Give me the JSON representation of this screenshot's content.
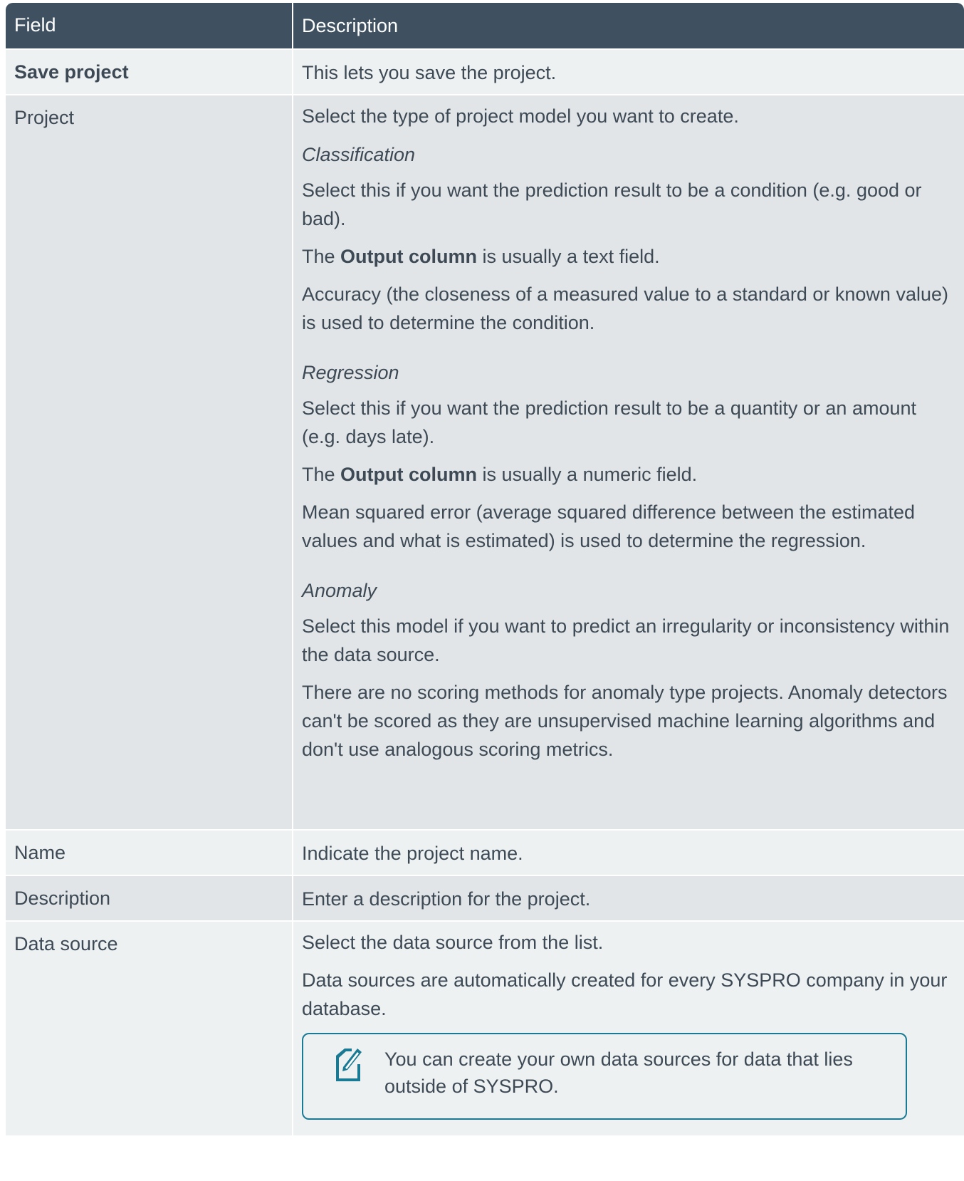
{
  "header": {
    "field": "Field",
    "description": "Description"
  },
  "rows": {
    "save": {
      "field": "Save project",
      "desc": "This lets you save the project."
    },
    "project": {
      "field": "Project",
      "intro": "Select the type of project model you want to create.",
      "classification": {
        "title": "Classification",
        "p1": "Select this if you want the prediction result to be a condition (e.g. good or bad).",
        "p2_pre": "The ",
        "p2_bold": "Output column",
        "p2_post": " is usually a text field.",
        "p3": "Accuracy (the closeness of a measured value to a standard or known value) is used to determine the condition."
      },
      "regression": {
        "title": "Regression",
        "p1": "Select this if you want the prediction result to be a quantity or an amount (e.g. days late).",
        "p2_pre": "The ",
        "p2_bold": "Output column",
        "p2_post": " is usually a numeric field.",
        "p3": "Mean squared error (average squared difference between the estimated values and what is estimated) is used to determine the regression."
      },
      "anomaly": {
        "title": "Anomaly",
        "p1": "Select this model if you want to predict an irregularity or inconsistency within the data source.",
        "p2": "There are no scoring methods for anomaly type projects. Anomaly detectors can't be scored as they are unsupervised machine learning algorithms and don't use analogous scoring metrics."
      }
    },
    "name": {
      "field": "Name",
      "desc": "Indicate the project name."
    },
    "description": {
      "field": "Description",
      "desc": "Enter a description for the project."
    },
    "datasource": {
      "field": "Data source",
      "p1": "Select the data source from the list.",
      "p2": "Data sources are automatically created for every SYSPRO company in your database.",
      "note": "You can create your own data sources for data that lies outside of SYSPRO."
    }
  },
  "colors": {
    "header_bg": "#3f5160",
    "note_border": "#1a7a93",
    "text": "#3d4a55"
  },
  "icons": {
    "note": "note-pencil-icon"
  }
}
